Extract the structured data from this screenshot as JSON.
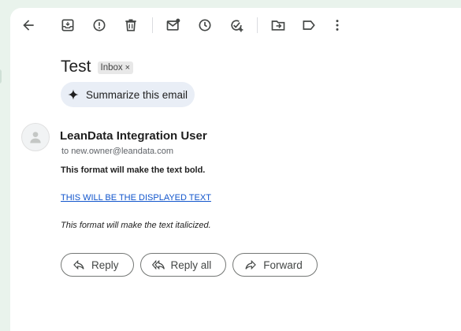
{
  "toolbar": {
    "icons": [
      "back-icon",
      "archive-icon",
      "report-spam-icon",
      "delete-icon",
      "mark-unread-icon",
      "snooze-icon",
      "add-to-tasks-icon",
      "move-to-icon",
      "label-icon",
      "more-options-icon"
    ]
  },
  "email": {
    "subject": "Test",
    "label_chip": "Inbox",
    "label_remove": "×",
    "summarize_label": "Summarize this email",
    "sender_name": "LeanData Integration User",
    "to_prefix": "to",
    "to_address": "new.owner@leandata.com",
    "body": {
      "bold_line": "This format will make the text bold.",
      "link_line": "THIS WILL BE THE DISPLAYED TEXT",
      "italic_line": "This format will make the text italicized."
    }
  },
  "actions": {
    "reply": "Reply",
    "reply_all": "Reply all",
    "forward": "Forward"
  },
  "colors": {
    "background": "#e9f3ec",
    "link": "#1155cc",
    "summarize_bg": "#e9eef6"
  }
}
